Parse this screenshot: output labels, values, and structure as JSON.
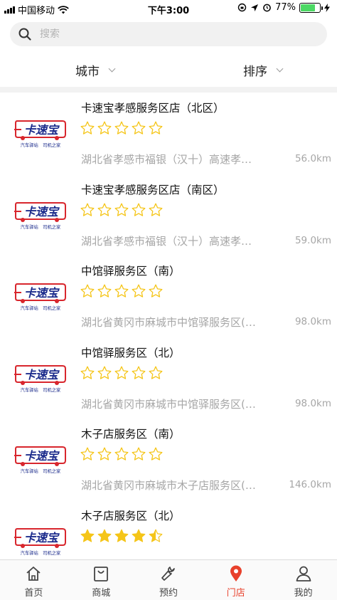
{
  "status_bar": {
    "carrier": "中国移动",
    "time": "下午3:00",
    "battery_percent": 77,
    "battery_label": "77%"
  },
  "search": {
    "placeholder": "搜索"
  },
  "filters": {
    "city_label": "城市",
    "sort_label": "排序"
  },
  "logo": {
    "brand": "卡速宝",
    "slogan": "汽车驿站　司机之家",
    "brand_color": "#1c2c8c",
    "accent_color": "#d8262d"
  },
  "stores": [
    {
      "name": "卡速宝孝感服务区店（北区）",
      "rating": 0,
      "address": "湖北省孝感市福银（汉十）高速孝…",
      "distance": "56.0km"
    },
    {
      "name": "卡速宝孝感服务区店（南区）",
      "rating": 0,
      "address": "湖北省孝感市福银（汉十）高速孝…",
      "distance": "59.0km"
    },
    {
      "name": "中馆驿服务区（南）",
      "rating": 0,
      "address": "湖北省黄冈市麻城市中馆驿服务区(…",
      "distance": "98.0km"
    },
    {
      "name": "中馆驿服务区（北）",
      "rating": 0,
      "address": "湖北省黄冈市麻城市中馆驿服务区(…",
      "distance": "98.0km"
    },
    {
      "name": "木子店服务区（南）",
      "rating": 0,
      "address": "湖北省黄冈市麻城市木子店服务区(…",
      "distance": "146.0km"
    },
    {
      "name": "木子店服务区（北）",
      "rating": 4.5,
      "address": "",
      "distance": ""
    }
  ],
  "tabs": [
    {
      "label": "首页",
      "icon": "home-icon",
      "active": false
    },
    {
      "label": "商城",
      "icon": "shopping-bag-icon",
      "active": false
    },
    {
      "label": "预约",
      "icon": "wrench-icon",
      "active": false
    },
    {
      "label": "门店",
      "icon": "location-pin-icon",
      "active": true
    },
    {
      "label": "我的",
      "icon": "user-icon",
      "active": false
    }
  ],
  "colors": {
    "accent": "#e8412c",
    "star": "#f5c518",
    "secondary_text": "#a6a6a6"
  }
}
